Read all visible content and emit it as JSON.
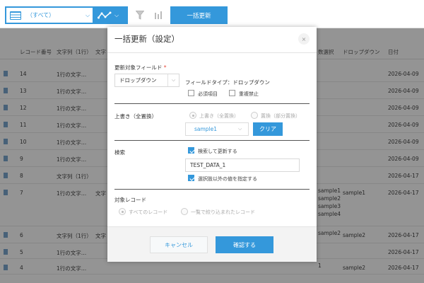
{
  "toolbar": {
    "view_label": "（すべて）",
    "bulk_update_label": "一括更新"
  },
  "list": {
    "headers": [
      "レコード番号",
      "文字列（1行）",
      "文字",
      "",
      "",
      "",
      "",
      "数選択",
      "ドロップダウン",
      "日付"
    ],
    "header_cols": {
      "record_no": "レコード番号",
      "text1": "文字列（1行）",
      "text2": "文字",
      "multi_select": "数選択",
      "dropdown": "ドロップダウン",
      "date": "日付"
    },
    "rows": [
      {
        "id": "14",
        "text1": "1行の文字…",
        "text2": "",
        "multi": "",
        "dropdown": "",
        "date": "2026-04-09"
      },
      {
        "id": "13",
        "text1": "1行の文字…",
        "text2": "",
        "multi": "",
        "dropdown": "",
        "date": "2026-04-09"
      },
      {
        "id": "12",
        "text1": "1行の文字…",
        "text2": "",
        "multi": "",
        "dropdown": "",
        "date": "2026-04-09"
      },
      {
        "id": "11",
        "text1": "1行の文字…",
        "text2": "",
        "multi": "",
        "dropdown": "",
        "date": "2026-04-09"
      },
      {
        "id": "10",
        "text1": "1行の文字…",
        "text2": "",
        "multi": "",
        "dropdown": "",
        "date": "2026-04-09"
      },
      {
        "id": "9",
        "text1": "1行の文字…",
        "text2": "",
        "multi": "",
        "dropdown": "",
        "date": "2026-04-09"
      },
      {
        "id": "8",
        "text1": "文字列（1行）",
        "text2": "",
        "multi": "",
        "dropdown": "",
        "date": "2026-04-17"
      },
      {
        "id": "7",
        "text1": "1行の文字…",
        "text2": "文字",
        "multi": "sample1\nsample2\nsample3\nsample4",
        "dropdown": "sample1",
        "date": "2026-04-17"
      },
      {
        "id": "6",
        "text1": "文字列（1行）",
        "text2": "文字",
        "multi": "sample2",
        "dropdown": "sample2",
        "date": "2026-04-17"
      },
      {
        "id": "5",
        "text1": "1行の文字…",
        "text2": "",
        "multi": "",
        "dropdown": "",
        "date": "2026-04-17"
      },
      {
        "id": "4",
        "text1": "1行の文字…",
        "text2": "",
        "multi": "1",
        "dropdown": "sample2",
        "date": "2026-04-17"
      }
    ]
  },
  "modal": {
    "title": "一括更新（設定）",
    "close_glyph": "×",
    "target_field_label": "更新対象フィールド",
    "required_mark": "*",
    "field_value": "ドロップダウン",
    "field_type": "フィールドタイプ：ドロップダウン",
    "required_label": "必須項目",
    "no_dup_label": "重複禁止",
    "overwrite_label": "上書き（全置換）",
    "radio_overwrite": "上書き（全置換）",
    "radio_replace": "置換（部分置換）",
    "value_select": "sample1",
    "clear_label": "クリア",
    "search_label": "検索",
    "search_update_label": "検索して更新する",
    "search_value": "TEST_DATA_1",
    "specify_other_label": "選択肢以外の値を指定する",
    "target_records_label": "対象レコード",
    "all_records": "すべてのレコード",
    "filtered_records": "一覧で絞り込まれたレコード",
    "cancel_label": "キャンセル",
    "confirm_label": "確認する"
  },
  "colors": {
    "accent": "#3498db",
    "required": "#e74c3c"
  },
  "icons": [
    "table-icon",
    "chevron-down-icon",
    "graph-icon",
    "filter-icon",
    "bar-chart-icon",
    "close-icon",
    "document-icon"
  ]
}
